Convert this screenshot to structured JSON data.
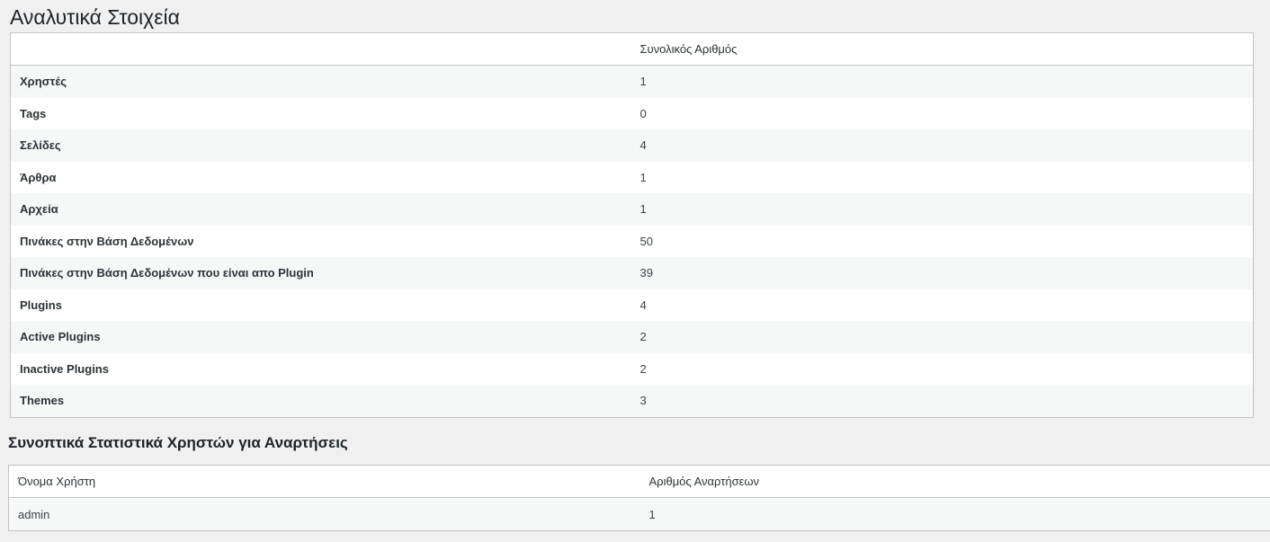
{
  "page_title": "Αναλυτικά Στοιχεία",
  "details_table": {
    "headers": [
      "",
      "Συνολικός Αριθμός"
    ],
    "rows": [
      {
        "label": "Χρηστές",
        "value": "1"
      },
      {
        "label": "Tags",
        "value": "0"
      },
      {
        "label": "Σελίδες",
        "value": "4"
      },
      {
        "label": "Άρθρα",
        "value": "1"
      },
      {
        "label": "Αρχεία",
        "value": "1"
      },
      {
        "label": "Πινάκες στην Βάση Δεδομένων",
        "value": "50"
      },
      {
        "label": "Πινάκες στην Βάση Δεδομένων που είναι απο Plugin",
        "value": "39"
      },
      {
        "label": "Plugins",
        "value": "4"
      },
      {
        "label": "Active Plugins",
        "value": "2"
      },
      {
        "label": "Inactive Plugins",
        "value": "2"
      },
      {
        "label": "Themes",
        "value": "3"
      }
    ]
  },
  "users_section": {
    "title": "Συνοπτικά Στατιστικά Χρηστών για Αναρτήσεις",
    "headers": [
      "Όνομα Χρήστη",
      "Αριθμός Αναρτήσεων"
    ],
    "rows": [
      {
        "username": "admin",
        "posts": "1"
      }
    ]
  }
}
